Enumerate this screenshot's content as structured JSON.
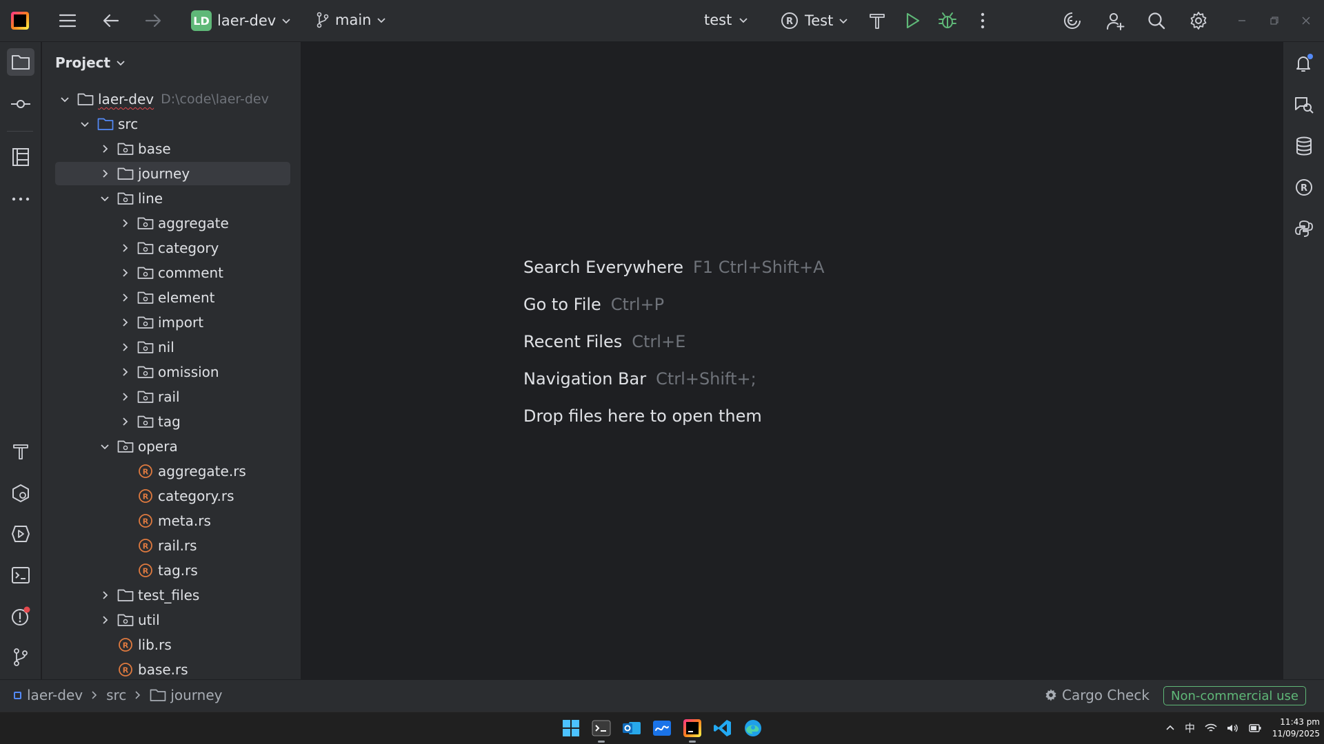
{
  "titlebar": {
    "project_initials": "LD",
    "project_name": "laer-dev",
    "branch": "main",
    "run_config_left": "test",
    "run_config": "Test"
  },
  "project_panel": {
    "title": "Project",
    "tree": [
      {
        "label": "laer-dev",
        "path": "D:\\code\\laer-dev",
        "type": "root",
        "depth": 0,
        "expanded": true
      },
      {
        "label": "src",
        "type": "source-folder",
        "depth": 1,
        "expanded": true
      },
      {
        "label": "base",
        "type": "module",
        "depth": 2,
        "expanded": false
      },
      {
        "label": "journey",
        "type": "folder",
        "depth": 2,
        "expanded": false,
        "selected": true
      },
      {
        "label": "line",
        "type": "module",
        "depth": 2,
        "expanded": true
      },
      {
        "label": "aggregate",
        "type": "module",
        "depth": 3,
        "expanded": false
      },
      {
        "label": "category",
        "type": "module",
        "depth": 3,
        "expanded": false
      },
      {
        "label": "comment",
        "type": "module",
        "depth": 3,
        "expanded": false
      },
      {
        "label": "element",
        "type": "module",
        "depth": 3,
        "expanded": false
      },
      {
        "label": "import",
        "type": "module",
        "depth": 3,
        "expanded": false
      },
      {
        "label": "nil",
        "type": "module",
        "depth": 3,
        "expanded": false
      },
      {
        "label": "omission",
        "type": "module",
        "depth": 3,
        "expanded": false
      },
      {
        "label": "rail",
        "type": "module",
        "depth": 3,
        "expanded": false
      },
      {
        "label": "tag",
        "type": "module",
        "depth": 3,
        "expanded": false
      },
      {
        "label": "opera",
        "type": "module",
        "depth": 2,
        "expanded": true
      },
      {
        "label": "aggregate.rs",
        "type": "rust-file",
        "depth": 3
      },
      {
        "label": "category.rs",
        "type": "rust-file",
        "depth": 3
      },
      {
        "label": "meta.rs",
        "type": "rust-file",
        "depth": 3
      },
      {
        "label": "rail.rs",
        "type": "rust-file",
        "depth": 3
      },
      {
        "label": "tag.rs",
        "type": "rust-file",
        "depth": 3
      },
      {
        "label": "test_files",
        "type": "folder",
        "depth": 2,
        "expanded": false
      },
      {
        "label": "util",
        "type": "module",
        "depth": 2,
        "expanded": false
      },
      {
        "label": "lib.rs",
        "type": "rust-file",
        "depth": 2
      },
      {
        "label": "base.rs",
        "type": "rust-file",
        "depth": 2
      }
    ]
  },
  "editor": {
    "hints": [
      {
        "action": "Search Everywhere",
        "shortcut": "F1 Ctrl+Shift+A"
      },
      {
        "action": "Go to File",
        "shortcut": "Ctrl+P"
      },
      {
        "action": "Recent Files",
        "shortcut": "Ctrl+E"
      },
      {
        "action": "Navigation Bar",
        "shortcut": "Ctrl+Shift+;"
      },
      {
        "action": "Drop files here to open them",
        "shortcut": ""
      }
    ]
  },
  "statusbar": {
    "breadcrumbs": [
      "laer-dev",
      "src",
      "journey"
    ],
    "cargo_check": "Cargo Check",
    "license": "Non-commercial use"
  },
  "taskbar": {
    "tray_ime": "中",
    "time": "11:43 pm",
    "date": "11/09/2025"
  },
  "colors": {
    "background": "#1e1f22",
    "panel": "#2b2d30",
    "selection": "#393b40",
    "text": "#dfe1e5",
    "muted": "#6f737a",
    "accent_blue": "#548af7",
    "run_green": "#5fb878",
    "rust_orange": "#e07a3f",
    "error_red": "#e5484d"
  }
}
